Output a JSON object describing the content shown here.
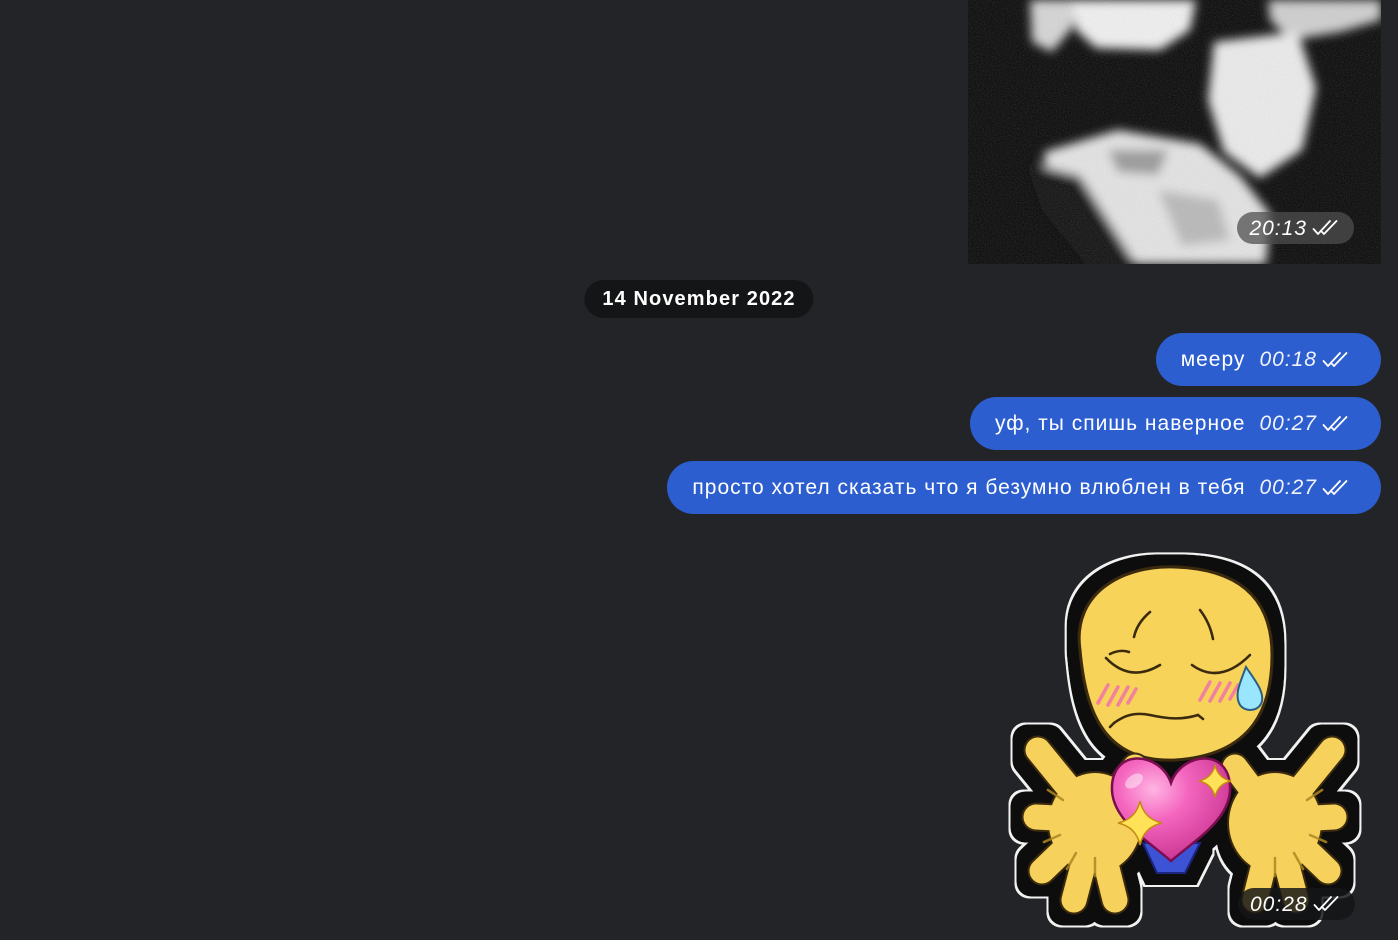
{
  "theme": {
    "background": "#232427",
    "outgoing_bubble": "#2d5ecf",
    "date_pill": "#141517",
    "text": "#ffffff"
  },
  "photo_message": {
    "time": "20:13",
    "status_icon": "double-check-icon"
  },
  "date_separator": {
    "label": "14 November 2022"
  },
  "messages": [
    {
      "text": "мееру",
      "time": "00:18",
      "status_icon": "double-check-icon"
    },
    {
      "text": "уф, ты спишь наверное",
      "time": "00:27",
      "status_icon": "double-check-icon"
    },
    {
      "text": "просто хотел сказать что я безумно влюблен в тебя",
      "time": "00:27",
      "status_icon": "double-check-icon"
    }
  ],
  "sticker_message": {
    "time": "00:28",
    "status_icon": "double-check-icon"
  }
}
